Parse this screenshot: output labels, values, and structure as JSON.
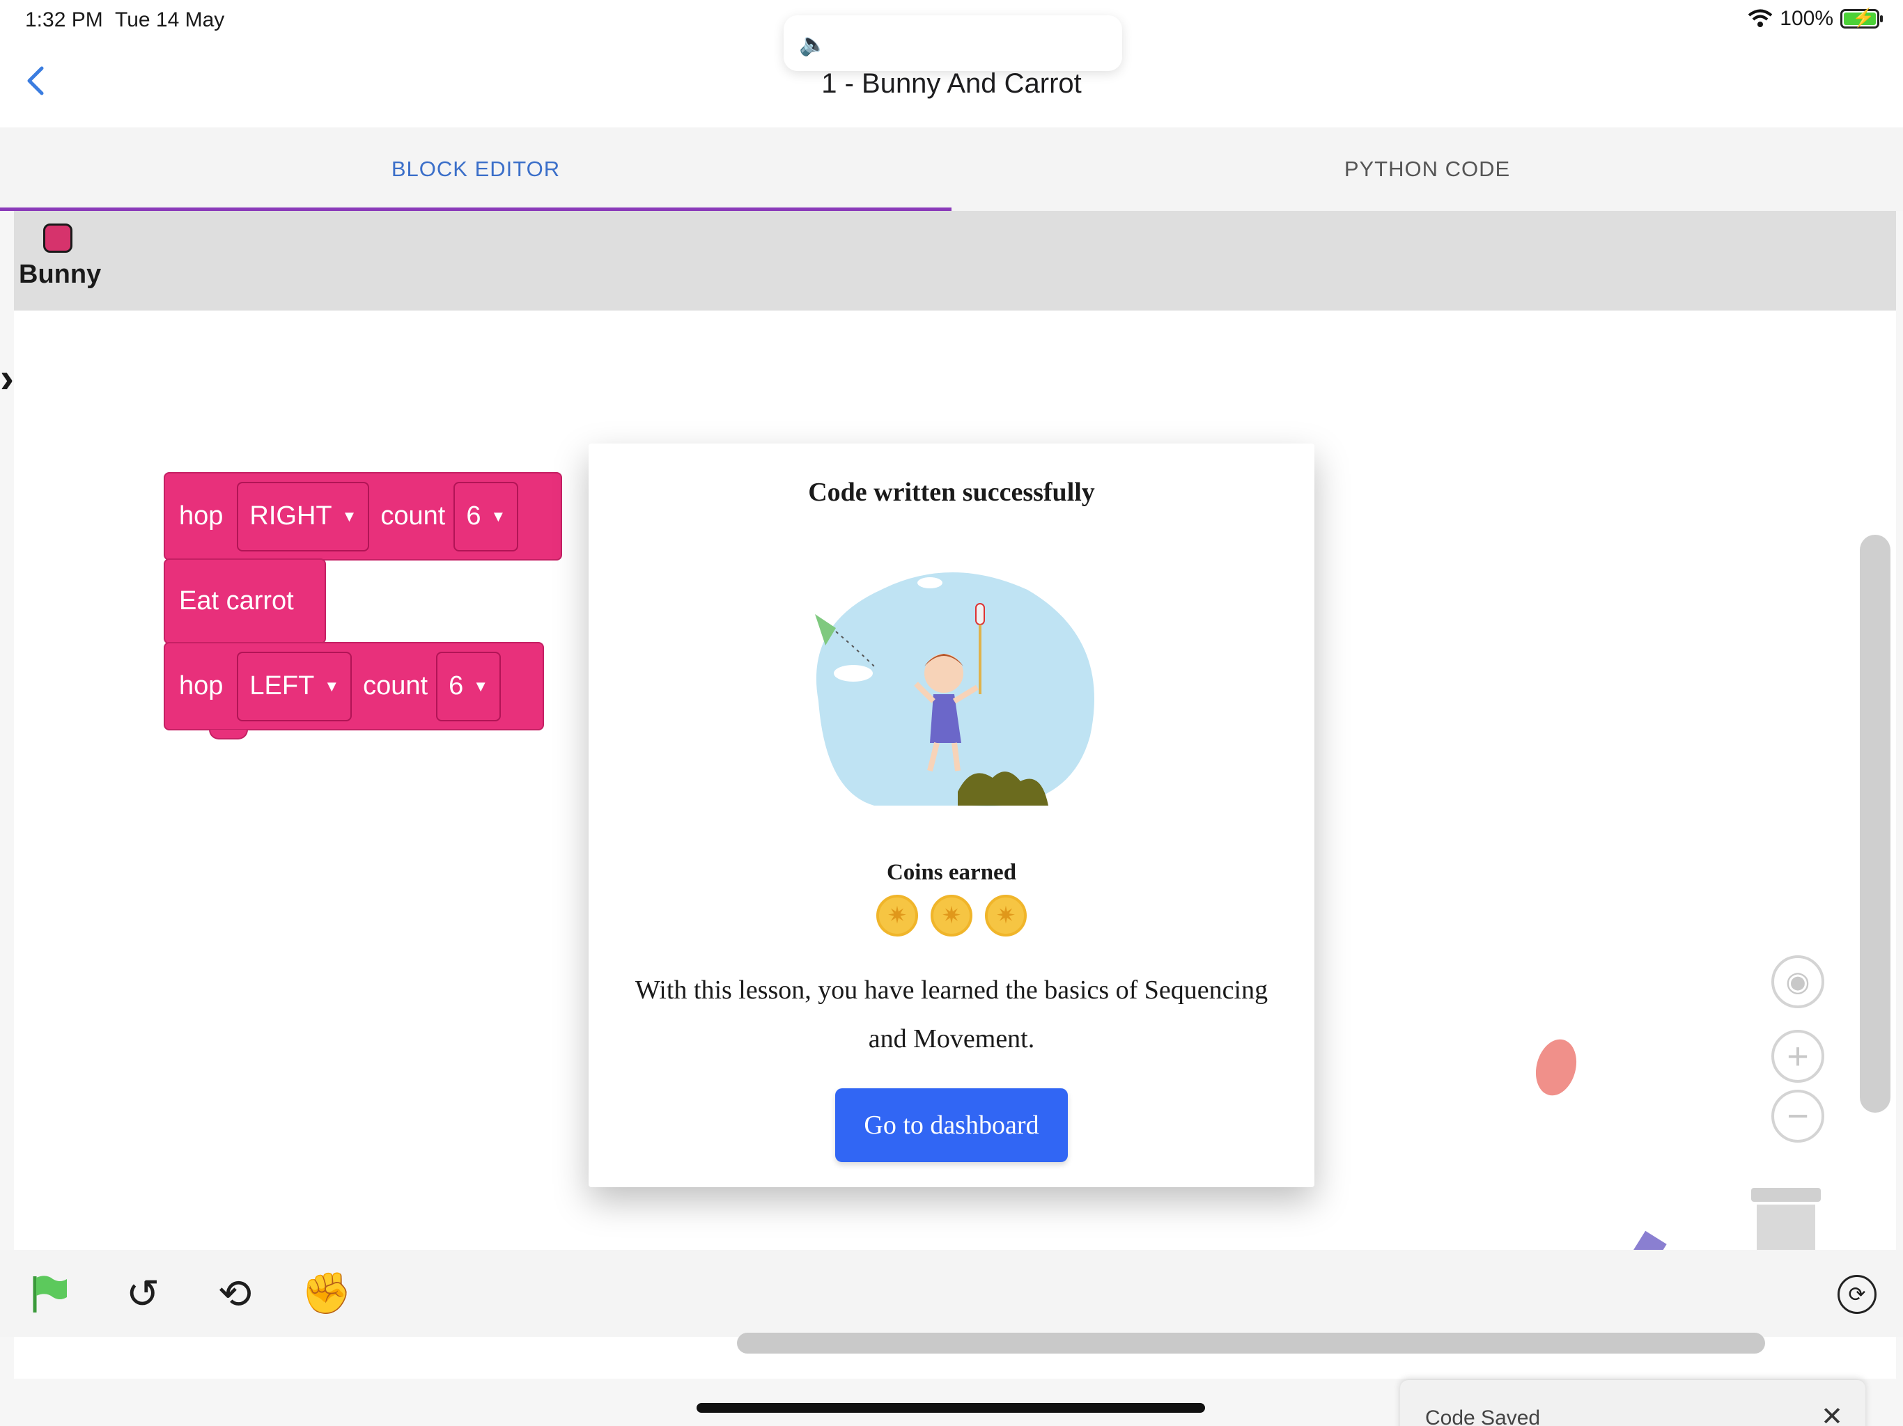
{
  "status_bar": {
    "time": "1:32 PM",
    "date": "Tue 14 May",
    "battery": "100%"
  },
  "header": {
    "title": "1 - Bunny And Carrot",
    "back_icon": "chevron-left-icon"
  },
  "tabs": [
    {
      "label": "BLOCK EDITOR",
      "active": true
    },
    {
      "label": "PYTHON CODE",
      "active": false
    }
  ],
  "sprite": {
    "name": "Bunny",
    "color": "#d6336c"
  },
  "blocks": [
    {
      "keyword": "hop",
      "direction": "RIGHT",
      "count_label": "count",
      "count": "6"
    },
    {
      "keyword": "Eat carrot"
    },
    {
      "keyword": "hop",
      "direction": "LEFT",
      "count_label": "count",
      "count": "6"
    }
  ],
  "modal": {
    "title": "Code written successfully",
    "coins_label": "Coins earned",
    "coins": 3,
    "message": "With this lesson, you have learned the basics of Sequencing and Movement.",
    "button": "Go to dashboard"
  },
  "toast": {
    "text": "Code Saved"
  },
  "colors": {
    "accent": "#3166f4",
    "tab_active": "#3b6fc9",
    "tab_underline": "#8a3ab9",
    "block": "#e8307b"
  }
}
